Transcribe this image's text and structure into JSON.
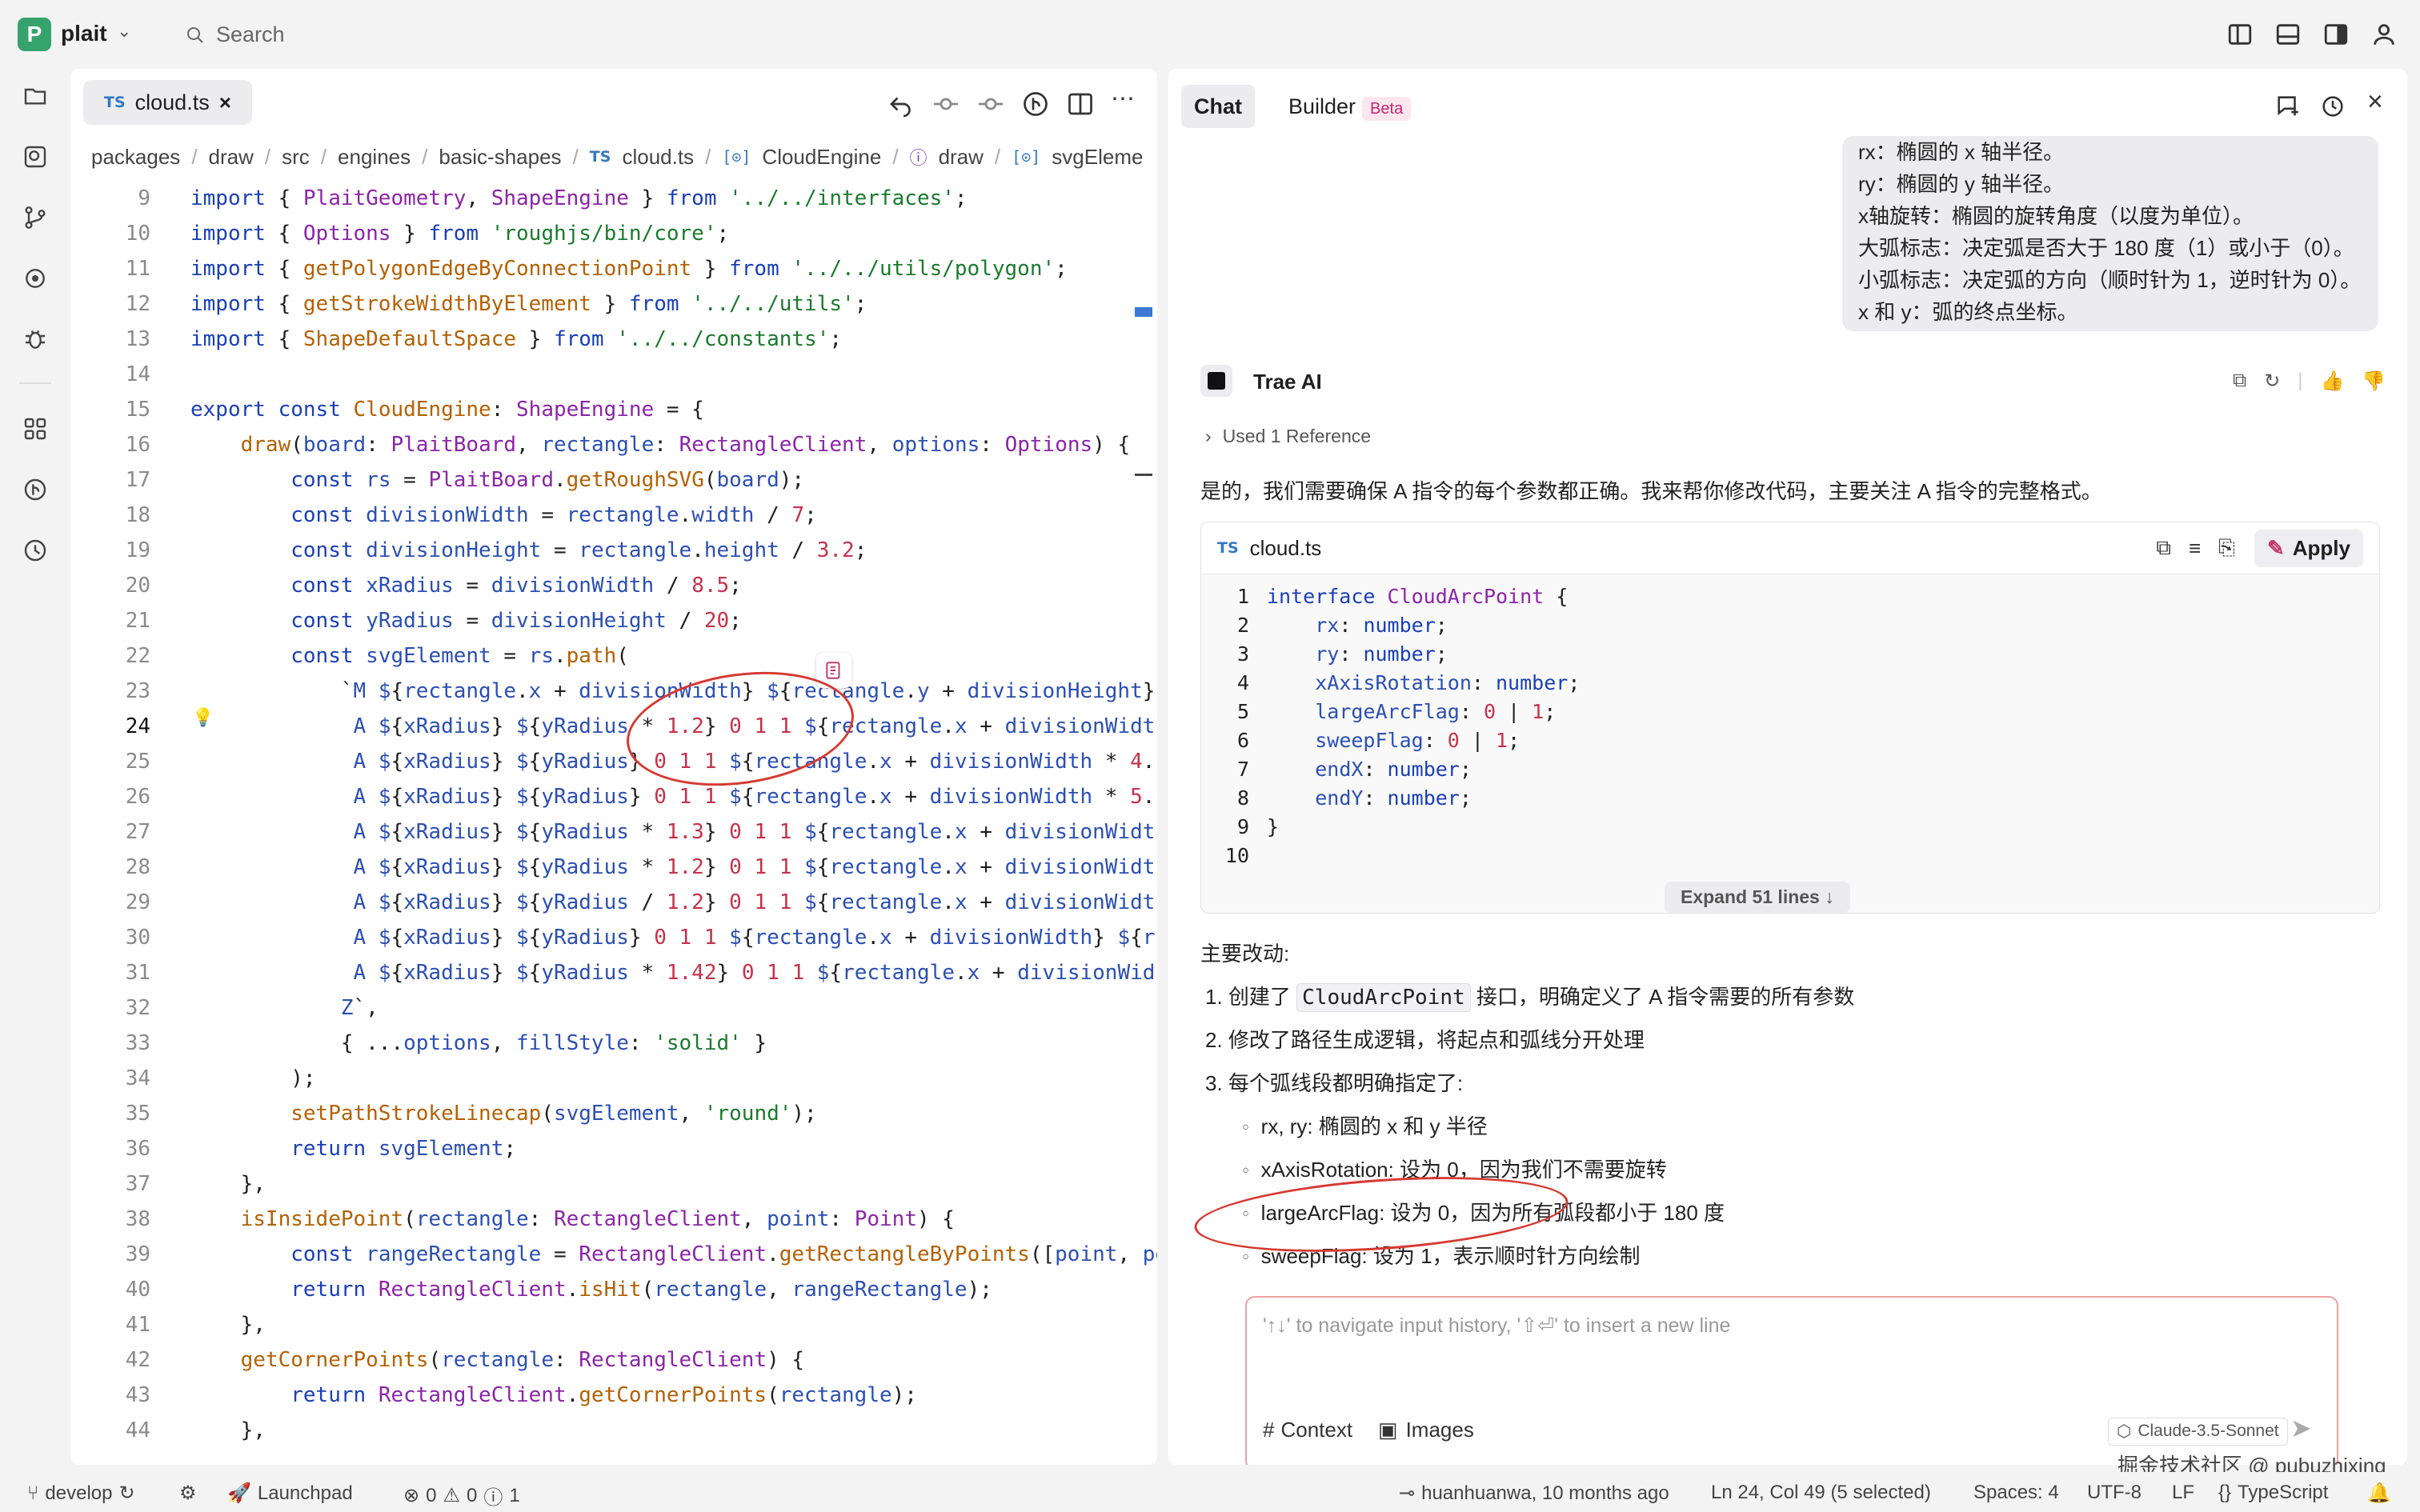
{
  "app": {
    "project_initial": "P",
    "project_name": "plait",
    "search_placeholder": "Search"
  },
  "editor": {
    "tab_lang": "TS",
    "tab_label": "cloud.ts",
    "breadcrumbs": [
      "packages",
      "draw",
      "src",
      "engines",
      "basic-shapes",
      "cloud.ts",
      "CloudEngine",
      "draw",
      "svgEleme"
    ],
    "current_line": 24,
    "lines": [
      {
        "n": 9,
        "text": "import { PlaitGeometry, ShapeEngine } from '../../interfaces';"
      },
      {
        "n": 10,
        "text": "import { Options } from 'roughjs/bin/core';"
      },
      {
        "n": 11,
        "text": "import { getPolygonEdgeByConnectionPoint } from '../../utils/polygon';"
      },
      {
        "n": 12,
        "text": "import { getStrokeWidthByElement } from '../../utils';"
      },
      {
        "n": 13,
        "text": "import { ShapeDefaultSpace } from '../../constants';"
      },
      {
        "n": 14,
        "text": ""
      },
      {
        "n": 15,
        "text": "export const CloudEngine: ShapeEngine = {"
      },
      {
        "n": 16,
        "text": "    draw(board: PlaitBoard, rectangle: RectangleClient, options: Options) {"
      },
      {
        "n": 17,
        "text": "        const rs = PlaitBoard.getRoughSVG(board);"
      },
      {
        "n": 18,
        "text": "        const divisionWidth = rectangle.width / 7;"
      },
      {
        "n": 19,
        "text": "        const divisionHeight = rectangle.height / 3.2;"
      },
      {
        "n": 20,
        "text": "        const xRadius = divisionWidth / 8.5;"
      },
      {
        "n": 21,
        "text": "        const yRadius = divisionHeight / 20;"
      },
      {
        "n": 22,
        "text": "        const svgElement = rs.path("
      },
      {
        "n": 23,
        "text": "            `M ${rectangle.x + divisionWidth} ${rectangle.y + divisionHeight}"
      },
      {
        "n": 24,
        "text": "             A ${xRadius} ${yRadius * 1.2} 0 1 1 ${rectangle.x + divisionWidt"
      },
      {
        "n": 25,
        "text": "             A ${xRadius} ${yRadius} 0 1 1 ${rectangle.x + divisionWidth * 4."
      },
      {
        "n": 26,
        "text": "             A ${xRadius} ${yRadius} 0 1 1 ${rectangle.x + divisionWidth * 5."
      },
      {
        "n": 27,
        "text": "             A ${xRadius} ${yRadius * 1.3} 0 1 1 ${rectangle.x + divisionWidt"
      },
      {
        "n": 28,
        "text": "             A ${xRadius} ${yRadius * 1.2} 0 1 1 ${rectangle.x + divisionWidt"
      },
      {
        "n": 29,
        "text": "             A ${xRadius} ${yRadius / 1.2} 0 1 1 ${rectangle.x + divisionWidt"
      },
      {
        "n": 30,
        "text": "             A ${xRadius} ${yRadius} 0 1 1 ${rectangle.x + divisionWidth} ${r"
      },
      {
        "n": 31,
        "text": "             A ${xRadius} ${yRadius * 1.42} 0 1 1 ${rectangle.x + divisionWid"
      },
      {
        "n": 32,
        "text": "            Z`,"
      },
      {
        "n": 33,
        "text": "            { ...options, fillStyle: 'solid' }"
      },
      {
        "n": 34,
        "text": "        );"
      },
      {
        "n": 35,
        "text": "        setPathStrokeLinecap(svgElement, 'round');"
      },
      {
        "n": 36,
        "text": "        return svgElement;"
      },
      {
        "n": 37,
        "text": "    },"
      },
      {
        "n": 38,
        "text": "    isInsidePoint(rectangle: RectangleClient, point: Point) {"
      },
      {
        "n": 39,
        "text": "        const rangeRectangle = RectangleClient.getRectangleByPoints([point, po"
      },
      {
        "n": 40,
        "text": "        return RectangleClient.isHit(rectangle, rangeRectangle);"
      },
      {
        "n": 41,
        "text": "    },"
      },
      {
        "n": 42,
        "text": "    getCornerPoints(rectangle: RectangleClient) {"
      },
      {
        "n": 43,
        "text": "        return RectangleClient.getCornerPoints(rectangle);"
      },
      {
        "n": 44,
        "text": "    },"
      }
    ]
  },
  "chat": {
    "tab_chat": "Chat",
    "tab_builder": "Builder",
    "beta_badge": "Beta",
    "user_message_lines": [
      "rx：椭圆的 x 轴半径。",
      "ry：椭圆的 y 轴半径。",
      "x轴旋转：椭圆的旋转角度（以度为单位）。",
      "大弧标志：决定弧是否大于 180 度（1）或小于（0）。",
      "小弧标志：决定弧的方向（顺时针为 1，逆时针为 0）。",
      "x 和 y：弧的终点坐标。"
    ],
    "assistant_name": "Trae AI",
    "reference_label": "Used 1 Reference",
    "intro": "是的，我们需要确保 A 指令的每个参数都正确。我来帮你修改代码，主要关注 A 指令的完整格式。",
    "code_lang": "TS",
    "code_file": "cloud.ts",
    "apply_label": "Apply",
    "code_lines": [
      {
        "n": 1,
        "text": "interface CloudArcPoint {"
      },
      {
        "n": 2,
        "text": "    rx: number;"
      },
      {
        "n": 3,
        "text": "    ry: number;"
      },
      {
        "n": 4,
        "text": "    xAxisRotation: number;"
      },
      {
        "n": 5,
        "text": "    largeArcFlag: 0 | 1;"
      },
      {
        "n": 6,
        "text": "    sweepFlag: 0 | 1;"
      },
      {
        "n": 7,
        "text": "    endX: number;"
      },
      {
        "n": 8,
        "text": "    endY: number;"
      },
      {
        "n": 9,
        "text": "}"
      },
      {
        "n": 10,
        "text": ""
      }
    ],
    "expand_label": "Expand 51 lines ↓",
    "changes_title": "主要改动:",
    "changes": [
      {
        "num": "1.",
        "before": "创建了 ",
        "code": "CloudArcPoint",
        "after": " 接口，明确定义了 A 指令需要的所有参数"
      },
      {
        "num": "2.",
        "before": "修改了路径生成逻辑，将起点和弧线分开处理",
        "code": "",
        "after": ""
      },
      {
        "num": "3.",
        "before": "每个弧线段都明确指定了:",
        "code": "",
        "after": ""
      }
    ],
    "sub_changes": [
      "rx, ry: 椭圆的 x 和 y 半径",
      "xAxisRotation: 设为 0，因为我们不需要旋转",
      "largeArcFlag: 设为 0，因为所有弧段都小于 180 度",
      "sweepFlag: 设为 1，表示顺时针方向绘制"
    ],
    "input_placeholder": "'↑↓' to navigate input history, '⇧⏎' to insert a new line",
    "context_label": "Context",
    "images_label": "Images",
    "model_label": "Claude-3.5-Sonnet"
  },
  "status": {
    "branch": "develop",
    "launchpad": "Launchpad",
    "errors": "0",
    "warnings": "0",
    "infos": "1",
    "blame": "huanhuanwa, 10 months ago",
    "position": "Ln 24, Col 49 (5 selected)",
    "spaces": "Spaces: 4",
    "encoding": "UTF-8",
    "eol": "LF",
    "language": "TypeScript"
  },
  "watermark": "掘金技术社区 @ pubuzhixing"
}
